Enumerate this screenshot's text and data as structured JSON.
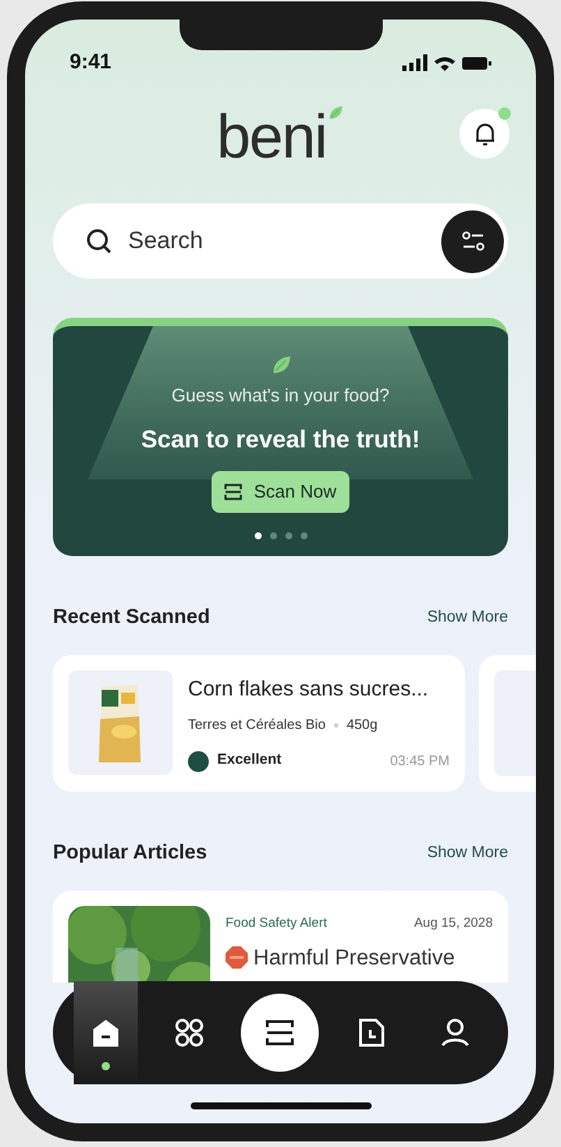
{
  "status_bar": {
    "time": "9:41"
  },
  "header": {
    "logo": "beni",
    "unread": true
  },
  "search": {
    "placeholder": "Search"
  },
  "banner": {
    "question": "Guess what's in your food?",
    "headline": "Scan to reveal the truth!",
    "button": "Scan Now",
    "dots": [
      {
        "selected": true
      },
      {
        "selected": false
      },
      {
        "selected": false
      },
      {
        "selected": false
      }
    ]
  },
  "recent": {
    "title": "Recent Scanned",
    "action": "Show More",
    "items": [
      {
        "name": "Corn flakes sans sucres...",
        "brand": "Terres et Céréales Bio",
        "weight": "450g",
        "rating": "Excellent",
        "color": "#1f4d43",
        "time": "03:45 PM"
      }
    ]
  },
  "articles": {
    "title": "Popular Articles",
    "action": "Show More",
    "items": [
      {
        "category": "Food Safety Alert",
        "date": "Aug 15, 2028",
        "title": "Harmful Preservative"
      }
    ]
  },
  "nav": [
    {
      "kind": "home",
      "selected": true
    },
    {
      "kind": "categories",
      "selected": false
    },
    {
      "kind": "scan",
      "selected": false
    },
    {
      "kind": "history",
      "selected": false
    },
    {
      "kind": "profile",
      "selected": false
    }
  ]
}
